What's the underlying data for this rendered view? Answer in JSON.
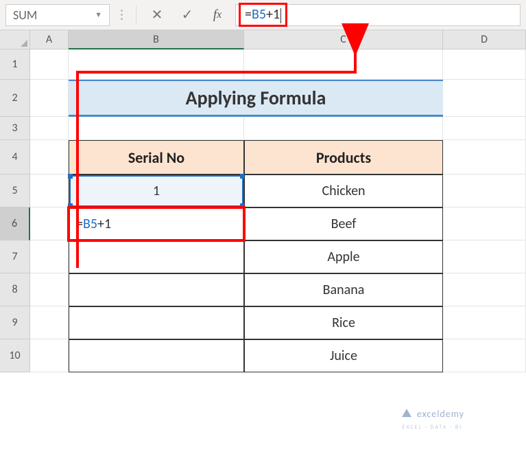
{
  "name_box": "SUM",
  "formula_bar": {
    "value_prefix": "=",
    "ref": "B5",
    "suffix": "+1"
  },
  "columns": [
    "A",
    "B",
    "C",
    "D"
  ],
  "rows": [
    "1",
    "2",
    "3",
    "4",
    "5",
    "6",
    "7",
    "8",
    "9",
    "10"
  ],
  "title": "Applying Formula",
  "headers": {
    "serial": "Serial No",
    "products": "Products"
  },
  "b5_value": "1",
  "b6_edit": "=B5+1",
  "products": [
    "Chicken",
    "Beef",
    "Apple",
    "Banana",
    "Rice",
    "Juice"
  ],
  "watermark": {
    "name": "exceldemy",
    "sub": "EXCEL · DATA · BI"
  },
  "chart_data": {
    "type": "table",
    "title": "Applying Formula",
    "columns": [
      "Serial No",
      "Products"
    ],
    "rows": [
      [
        "1",
        "Chicken"
      ],
      [
        "=B5+1",
        "Beef"
      ],
      [
        "",
        "Apple"
      ],
      [
        "",
        "Banana"
      ],
      [
        "",
        "Rice"
      ],
      [
        "",
        "Juice"
      ]
    ],
    "annotations": [
      "Formula bar shows =B5+1",
      "Cell B6 is being edited with =B5+1 referencing B5"
    ]
  }
}
